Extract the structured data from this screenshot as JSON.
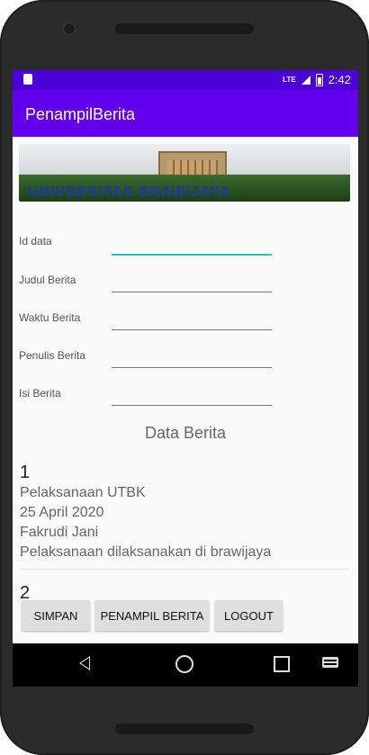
{
  "status": {
    "time": "2:42",
    "network": "LTE"
  },
  "app": {
    "title": "PenampilBerita"
  },
  "banner": {
    "text": "UNIVERSITAS BRAWIJAYA"
  },
  "form": {
    "fields": [
      {
        "label": "Id data",
        "value": ""
      },
      {
        "label": "Judul Berita",
        "value": ""
      },
      {
        "label": "Waktu Berita",
        "value": ""
      },
      {
        "label": "Penulis Berita",
        "value": ""
      },
      {
        "label": "Isi Berita",
        "value": ""
      }
    ]
  },
  "list": {
    "title": "Data Berita",
    "items": [
      {
        "id": "1",
        "judul": "Pelaksanaan UTBK",
        "waktu": "25 April 2020",
        "penulis": "Fakrudi Jani",
        "isi": "Pelaksanaan dilaksanakan di brawijaya"
      }
    ],
    "next_id": "2"
  },
  "buttons": {
    "simpan": "SIMPAN",
    "penampil": "PENAMPIL BERITA",
    "logout": "LOGOUT"
  },
  "colors": {
    "statusbar": "#4a00d9",
    "appbar": "#6200ee",
    "accent": "#23c7b5"
  }
}
